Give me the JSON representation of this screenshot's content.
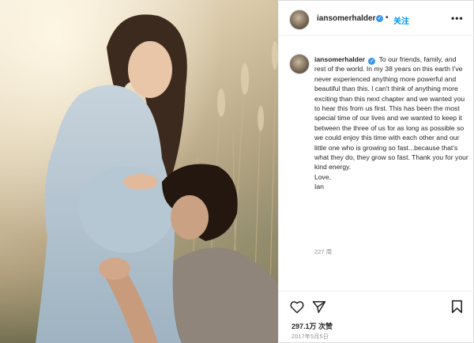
{
  "post": {
    "username": "iansomerhalder",
    "follow_label": "关注",
    "separator": "•",
    "more_label": "•••",
    "caption": "To our friends, family, and rest of the world. In my 38 years on this earth I've never experienced anything more powerful and beautiful than this. I can't think of anything more exciting than this next chapter and we wanted you to hear this from us first. This has been the most special time of our lives and we wanted to keep it between the three of us for as long as possible so we could enjoy this time with each other and our little one who is growing so fast...because that's what they do, they grow so fast. Thank you for your kind energy.",
    "sign_off_1": "Love,",
    "sign_off_2": "Ian",
    "time_ago": "227 周",
    "likes": "297.1万 次赞",
    "date": "2017年5月5日"
  },
  "icons": {
    "verified": "verified-badge-icon",
    "like": "heart-icon",
    "share": "paper-plane-icon",
    "save": "bookmark-icon",
    "more": "more-options-icon"
  },
  "colors": {
    "accent": "#0095f6",
    "verified": "#3897f0",
    "muted": "#8e8e8e",
    "text": "#262626"
  }
}
